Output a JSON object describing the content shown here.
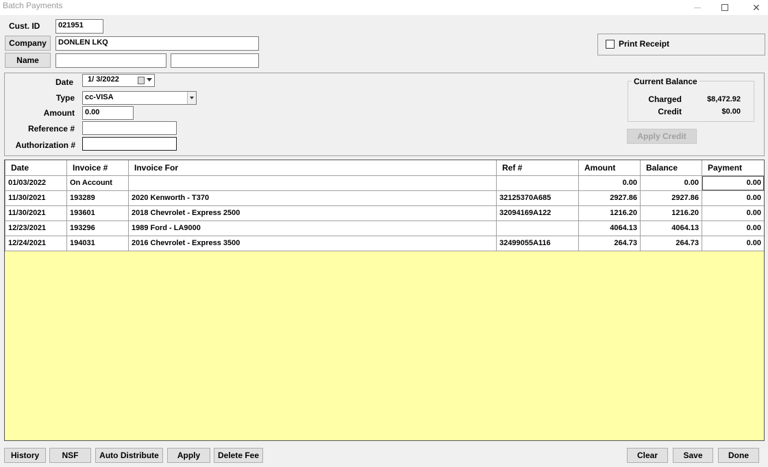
{
  "window": {
    "title": "Batch Payments"
  },
  "customer": {
    "cust_id_label": "Cust. ID",
    "cust_id": "021951",
    "company_button": "Company",
    "company": "DONLEN LKQ",
    "name_button": "Name",
    "name_first": "",
    "name_last": ""
  },
  "print_receipt": {
    "label": "Print Receipt",
    "checked": false
  },
  "payment": {
    "date_label": "Date",
    "date": "1/  3/2022",
    "type_label": "Type",
    "type": "cc-VISA",
    "amount_label": "Amount",
    "amount": "0.00",
    "reference_label": "Reference #",
    "reference": "",
    "authorization_label": "Authorization #",
    "authorization": ""
  },
  "balance": {
    "title": "Current Balance",
    "charged_label": "Charged",
    "charged": "$8,472.92",
    "credit_label": "Credit",
    "credit": "$0.00",
    "apply_credit": "Apply Credit"
  },
  "table": {
    "columns": [
      "Date",
      "Invoice #",
      "Invoice For",
      "Ref #",
      "Amount",
      "Balance",
      "Payment"
    ],
    "rows": [
      [
        "01/03/2022",
        "On Account",
        "",
        "",
        "0.00",
        "0.00",
        "0.00"
      ],
      [
        "11/30/2021",
        "193289",
        "2020 Kenworth - T370",
        "32125370A685",
        "2927.86",
        "2927.86",
        "0.00"
      ],
      [
        "11/30/2021",
        "193601",
        "2018 Chevrolet - Express 2500",
        "32094169A122",
        "1216.20",
        "1216.20",
        "0.00"
      ],
      [
        "12/23/2021",
        "193296",
        "1989 Ford - LA9000",
        "",
        "4064.13",
        "4064.13",
        "0.00"
      ],
      [
        "12/24/2021",
        "194031",
        "2016 Chevrolet - Express 3500",
        "32499055A116",
        "264.73",
        "264.73",
        "0.00"
      ]
    ]
  },
  "buttons": {
    "history": "History",
    "nsf": "NSF",
    "auto_distribute": "Auto Distribute",
    "apply": "Apply",
    "delete_fee": "Delete Fee",
    "clear": "Clear",
    "save": "Save",
    "done": "Done"
  },
  "colors": {
    "grid_background": "#ffffa8",
    "window_background": "#f0f0f0"
  }
}
